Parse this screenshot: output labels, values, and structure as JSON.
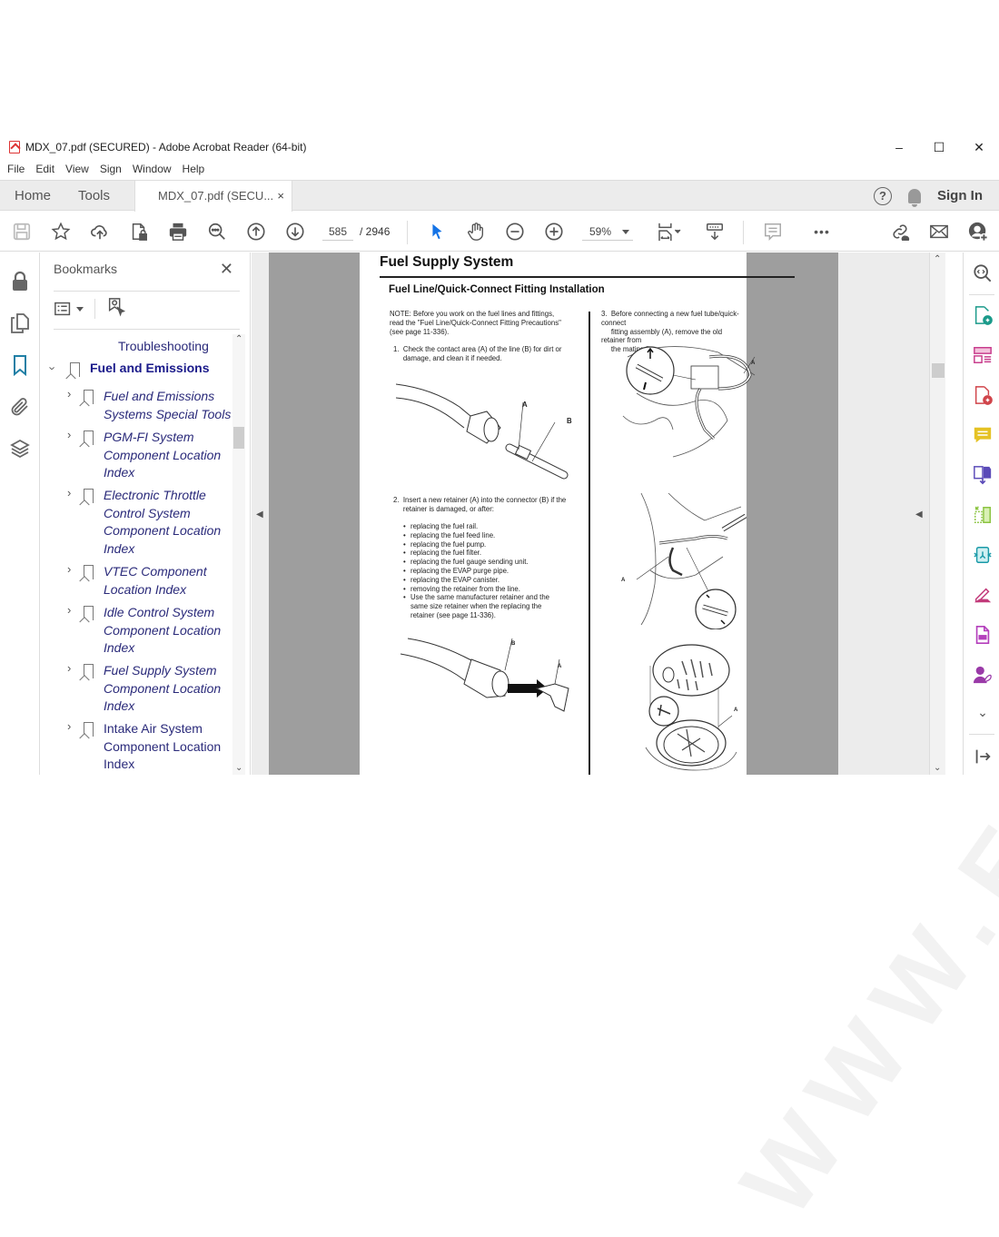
{
  "window": {
    "title": "MDX_07.pdf (SECURED) - Adobe Acrobat Reader (64-bit)",
    "controls": {
      "minimize": "–",
      "maximize": "☐",
      "close": "✕"
    }
  },
  "menu": [
    "File",
    "Edit",
    "View",
    "Sign",
    "Window",
    "Help"
  ],
  "tabs": {
    "home": "Home",
    "tools": "Tools",
    "document": "MDX_07.pdf (SECU...",
    "close": "×",
    "sign_in": "Sign In",
    "help": "?"
  },
  "toolbar": {
    "icons": [
      "save-icon",
      "bookmark-star-icon",
      "upload-cloud-icon",
      "secure-file-icon",
      "print-icon",
      "find-icon",
      "previous-page-icon",
      "next-page-icon",
      "select-cursor-icon",
      "hand-tool-icon",
      "zoom-out-icon",
      "zoom-in-icon",
      "fit-page-icon",
      "scroll-mode-icon",
      "comment-icon",
      "more-icon",
      "share-link-icon",
      "email-icon",
      "add-user-icon"
    ],
    "current_page": "585",
    "page_separator": "/ 2946",
    "zoom_level": "59%",
    "more": "•••"
  },
  "bookmarks": {
    "title": "Bookmarks",
    "close": "✕",
    "items": [
      {
        "label": "Troubleshooting",
        "lines": [
          "Troubleshooting"
        ],
        "level": 2,
        "style": "plain"
      },
      {
        "label": "Fuel and Emissions",
        "lines": [
          "Fuel and Emissions"
        ],
        "level": 1,
        "style": "bold",
        "expanded": true
      },
      {
        "label": "Fuel and Emissions Systems Special Tools",
        "lines": [
          "Fuel and Emissions",
          "Systems Special Tools"
        ],
        "level": 2,
        "style": "italic"
      },
      {
        "label": "PGM-FI System Component Location Index",
        "lines": [
          "PGM-FI System",
          "Component Location",
          "Index"
        ],
        "level": 2,
        "style": "italic"
      },
      {
        "label": "Electronic Throttle Control System Component Location Index",
        "lines": [
          "Electronic Throttle",
          "Control System",
          "Component Location",
          "Index"
        ],
        "level": 2,
        "style": "italic"
      },
      {
        "label": "VTEC Component Location Index",
        "lines": [
          "VTEC Component",
          "Location Index"
        ],
        "level": 2,
        "style": "italic"
      },
      {
        "label": "Idle Control System Component Location Index",
        "lines": [
          "Idle Control System",
          "Component Location",
          "Index"
        ],
        "level": 2,
        "style": "italic"
      },
      {
        "label": "Fuel Supply System Component Location Index",
        "lines": [
          "Fuel Supply System",
          "Component Location",
          "Index"
        ],
        "level": 2,
        "style": "italic"
      },
      {
        "label": "Intake Air System Component Location Index",
        "lines": [
          "Intake Air System",
          "Component Location",
          "Index"
        ],
        "level": 2,
        "style": "plain"
      }
    ]
  },
  "document": {
    "title": "Fuel Supply System",
    "subtitle": "Fuel Line/Quick-Connect Fitting Installation",
    "note": "NOTE: Before you work on the fuel lines and fittings,\nread the \"Fuel Line/Quick-Connect Fitting Precautions\"\n(see page 11-336).",
    "step1": "1.  Check the contact area (A) of the line (B) for dirt or\n     damage, and clean it if needed.",
    "step2": "2.  Insert a new retainer (A) into the connector (B) if the\n     retainer is damaged, or after:",
    "step2_bullets": [
      "replacing the fuel rail.",
      "replacing the fuel feed line.",
      "replacing the fuel pump.",
      "replacing the fuel filter.",
      "replacing the fuel gauge sending unit.",
      "replacing the EVAP purge pipe.",
      "replacing the EVAP canister.",
      "removing the retainer from the line.",
      "Use the same manufacturer retainer and the\nsame size retainer when the replacing the\nretainer (see page 11-336)."
    ],
    "step3": "3.  Before connecting a new fuel tube/quick-connect\n     fitting assembly (A), remove the old retainer from\n     the mating line.",
    "labels": {
      "a": "A",
      "b": "B"
    },
    "watermark": "WWW.E-DEP.COM"
  },
  "colors": {
    "accent_blue": "#1473e6",
    "bookmark_text": "#2a2a7a",
    "viewer_bg": "#9e9e9e"
  }
}
